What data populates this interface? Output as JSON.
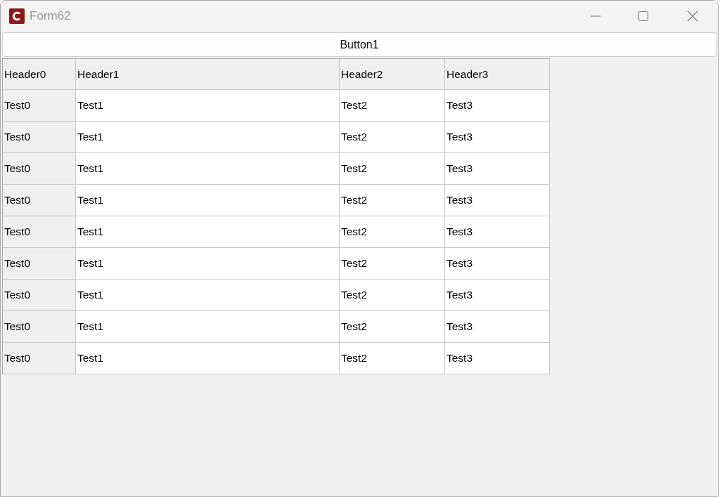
{
  "window": {
    "title": "Form62"
  },
  "button": {
    "label": "Button1"
  },
  "table": {
    "columns": [
      {
        "label": "Header0",
        "fixed": true
      },
      {
        "label": "Header1",
        "fixed": false
      },
      {
        "label": "Header2",
        "fixed": false
      },
      {
        "label": "Header3",
        "fixed": false
      }
    ],
    "rows": [
      [
        "Test0",
        "Test1",
        "Test2",
        "Test3"
      ],
      [
        "Test0",
        "Test1",
        "Test2",
        "Test3"
      ],
      [
        "Test0",
        "Test1",
        "Test2",
        "Test3"
      ],
      [
        "Test0",
        "Test1",
        "Test2",
        "Test3"
      ],
      [
        "Test0",
        "Test1",
        "Test2",
        "Test3"
      ],
      [
        "Test0",
        "Test1",
        "Test2",
        "Test3"
      ],
      [
        "Test0",
        "Test1",
        "Test2",
        "Test3"
      ],
      [
        "Test0",
        "Test1",
        "Test2",
        "Test3"
      ],
      [
        "Test0",
        "Test1",
        "Test2",
        "Test3"
      ]
    ]
  }
}
